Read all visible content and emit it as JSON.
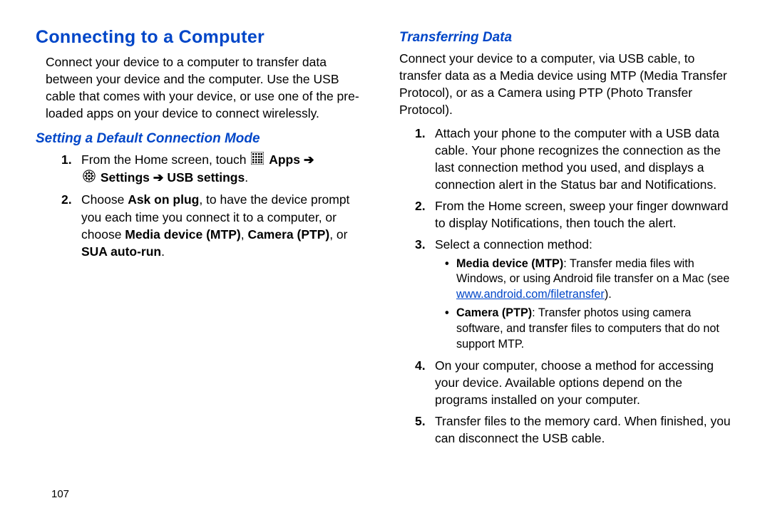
{
  "left": {
    "h1": "Connecting to a Computer",
    "intro": "Connect your device to a computer to transfer data between your device and the computer. Use the USB cable that comes with your device, or use one of the pre-loaded apps on your device to connect wirelessly.",
    "h2": "Setting a Default Connection Mode",
    "step1_a": "From the Home screen, touch ",
    "step1_b": "Apps",
    "step1_arrow": " ➔",
    "step1_c": "Settings",
    "step1_arrow2": " ➔ ",
    "step1_d": "USB settings",
    "step1_e": ".",
    "step2_a": "Choose ",
    "step2_b": "Ask on plug",
    "step2_c": ", to have the device prompt you each time you connect it to a computer, or choose ",
    "step2_d": "Media device (MTP)",
    "step2_e": ", ",
    "step2_f": "Camera (PTP)",
    "step2_g": ", or ",
    "step2_h": "SUA auto-run",
    "step2_i": "."
  },
  "right": {
    "h2": "Transferring Data",
    "intro": "Connect your device to a computer, via USB cable, to transfer data as a Media device using MTP (Media Transfer Protocol), or as a Camera using PTP (Photo Transfer Protocol).",
    "step1": "Attach your phone to the computer with a USB data cable. Your phone recognizes the connection as the last connection method you used, and displays a connection alert in the Status bar and Notifications.",
    "step2": "From the Home screen, sweep your finger downward to display Notifications, then touch the alert.",
    "step3": "Select a connection method:",
    "bullet1_a": "Media device (MTP)",
    "bullet1_b": ": Transfer media files with Windows, or using Android file transfer on a Mac (see ",
    "bullet1_link": "www.android.com/filetransfer",
    "bullet1_c": ").",
    "bullet2_a": "Camera (PTP)",
    "bullet2_b": ": Transfer photos using camera software, and transfer files to computers that do not support MTP.",
    "step4": "On your computer, choose a method for accessing your device. Available options depend on the programs installed on your computer.",
    "step5": "Transfer files to the memory card. When finished, you can disconnect the USB cable."
  },
  "page_number": "107"
}
